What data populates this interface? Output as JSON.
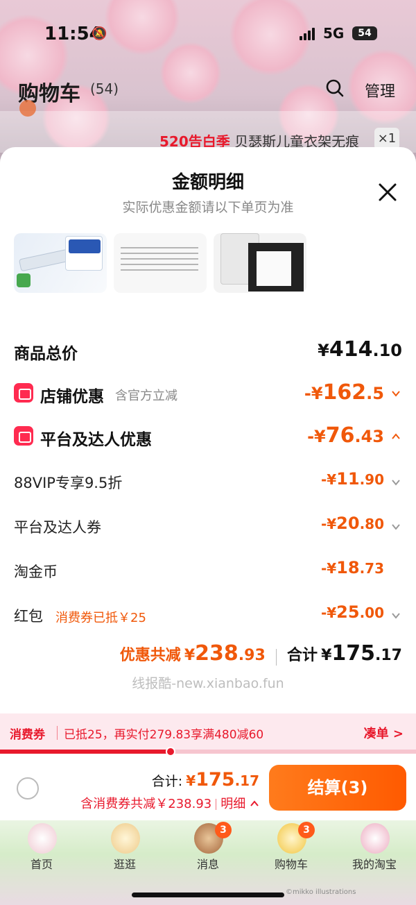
{
  "status": {
    "time": "11:54",
    "network": "5G",
    "battery": "54"
  },
  "header": {
    "title": "购物车",
    "count": "(54)",
    "manage": "管理"
  },
  "behind": {
    "tag": "520告白季",
    "title": "贝瑟斯儿童衣架无痕",
    "qty": "×1"
  },
  "sheet": {
    "title": "金额明细",
    "subtitle": "实际优惠金额请以下单页为准",
    "goods_total": {
      "label": "商品总价",
      "yen": "¥",
      "int": "414",
      "dec": ".10"
    },
    "shop_discount": {
      "label": "店铺优惠",
      "hint": "含官方立减",
      "sign": "-¥",
      "int": "162",
      "dec": ".5"
    },
    "platform_discount": {
      "label": "平台及达人优惠",
      "sign": "-¥",
      "int": "76",
      "dec": ".43"
    },
    "vip": {
      "label": "88VIP专享9.5折",
      "sign": "-¥",
      "int": "11",
      "dec": ".90"
    },
    "platform_coupon": {
      "label": "平台及达人券",
      "sign": "-¥",
      "int": "20",
      "dec": ".80"
    },
    "taojinbi": {
      "label": "淘金币",
      "sign": "-¥",
      "int": "18",
      "dec": ".73"
    },
    "hongbao": {
      "label": "红包",
      "hint": "消费券已抵￥25",
      "sign": "-¥",
      "int": "25",
      "dec": ".00"
    },
    "total_discount": {
      "label": "优惠共减",
      "yen": "¥",
      "int": "238",
      "dec": ".93"
    },
    "total": {
      "label": "合计",
      "yen": "¥",
      "int": "175",
      "dec": ".17"
    },
    "watermark": "线报酷-new.xianbao.fun"
  },
  "coupon_bar": {
    "label": "消费券",
    "text": "已抵25，再实付279.83享满480减60",
    "action": "凑单 >",
    "progress": 0.41
  },
  "checkout": {
    "sum_label": "合计:",
    "yen": "¥",
    "int": "175",
    "dec": ".17",
    "discount_text": "含消费券共减￥238.93",
    "detail": "明细",
    "pay_button": "结算(3)"
  },
  "tabbar": {
    "items": [
      {
        "label": "首页",
        "badge": ""
      },
      {
        "label": "逛逛",
        "badge": ""
      },
      {
        "label": "消息",
        "badge": "3"
      },
      {
        "label": "购物车",
        "badge": "3"
      },
      {
        "label": "我的淘宝",
        "badge": ""
      }
    ],
    "credit": "©mikko illustrations"
  },
  "colors": {
    "accent": "#f0580a",
    "red": "#e8192c",
    "pay_btn": "#ff5a00"
  }
}
